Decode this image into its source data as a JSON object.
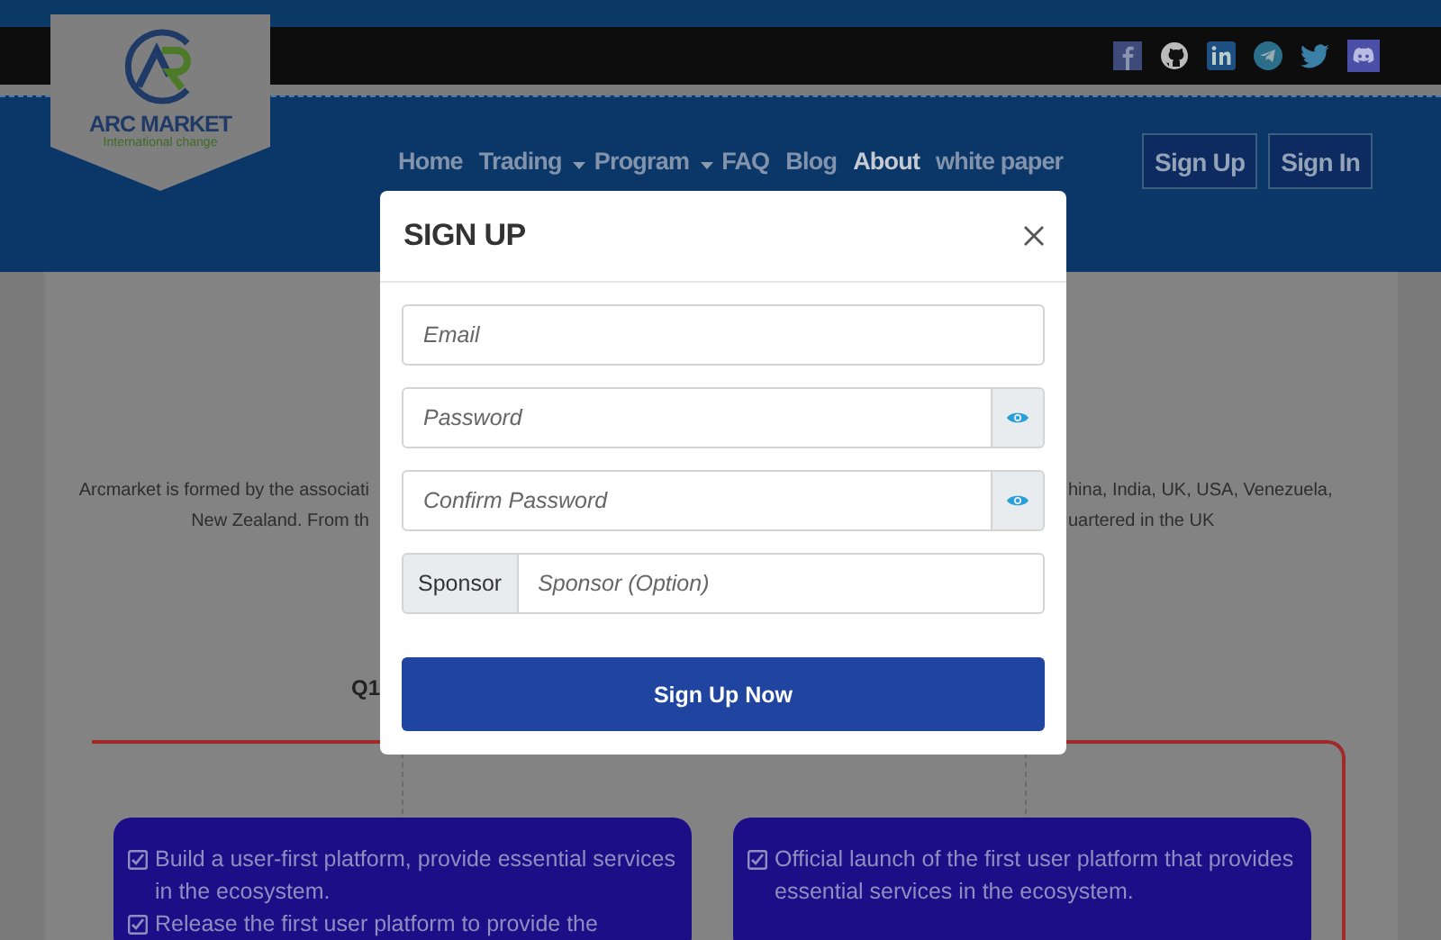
{
  "logo": {
    "name": "ARC MARKET",
    "tagline": "International change"
  },
  "nav": [
    {
      "label": "Home",
      "selected": false,
      "dropdown": false
    },
    {
      "label": "Trading",
      "selected": false,
      "dropdown": true
    },
    {
      "label": "Program",
      "selected": false,
      "dropdown": true
    },
    {
      "label": "FAQ",
      "selected": false,
      "dropdown": false
    },
    {
      "label": "Blog",
      "selected": false,
      "dropdown": false
    },
    {
      "label": "About",
      "selected": true,
      "dropdown": false
    },
    {
      "label": "white paper",
      "selected": false,
      "dropdown": false
    }
  ],
  "auth_buttons": [
    "Sign Up",
    "Sign In"
  ],
  "intro": {
    "left_lines": [
      "Arcmarket is formed by the associati",
      "New Zealand. From th"
    ],
    "right_lines": [
      "hina, India, UK, USA, Venezuela,",
      "uartered in the UK"
    ]
  },
  "timeline": {
    "label": "Q1",
    "boxes": [
      {
        "items": [
          "Build a user-first platform, provide essential services in the ecosystem.",
          "Release the first user platform to provide the"
        ]
      },
      {
        "items": [
          "Official launch of the first user platform that provides essential services in the ecosystem."
        ]
      }
    ]
  },
  "modal": {
    "title": "SIGN UP",
    "fields": [
      {
        "kind": "text",
        "placeholder": "Email"
      },
      {
        "kind": "password",
        "placeholder": "Password"
      },
      {
        "kind": "password",
        "placeholder": "Confirm Password"
      },
      {
        "kind": "addon",
        "addon": "Sponsor",
        "placeholder": "Sponsor (Option)"
      }
    ],
    "submit": "Sign Up Now"
  }
}
